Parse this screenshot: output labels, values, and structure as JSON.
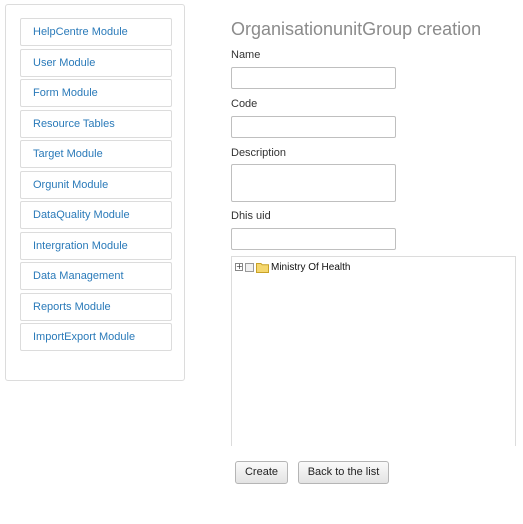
{
  "sidebar": {
    "items": [
      {
        "label": "HelpCentre Module"
      },
      {
        "label": "User Module"
      },
      {
        "label": "Form Module"
      },
      {
        "label": "Resource Tables"
      },
      {
        "label": "Target Module"
      },
      {
        "label": "Orgunit Module"
      },
      {
        "label": "DataQuality Module"
      },
      {
        "label": "Intergration Module"
      },
      {
        "label": "Data Management"
      },
      {
        "label": "Reports Module"
      },
      {
        "label": "ImportExport Module"
      }
    ]
  },
  "form": {
    "title": "OrganisationunitGroup creation",
    "name_label": "Name",
    "name_value": "",
    "code_label": "Code",
    "code_value": "",
    "description_label": "Description",
    "description_value": "",
    "uid_label": "Dhis uid",
    "uid_value": ""
  },
  "tree": {
    "root": {
      "label": "Ministry Of Health",
      "expander": "+",
      "folder_icon": "folder-icon"
    }
  },
  "buttons": {
    "create_label": "Create",
    "back_label": "Back to the list"
  },
  "colors": {
    "link": "#2a7ab9",
    "title": "#8b8b8b",
    "folder": "#f5d76e"
  }
}
